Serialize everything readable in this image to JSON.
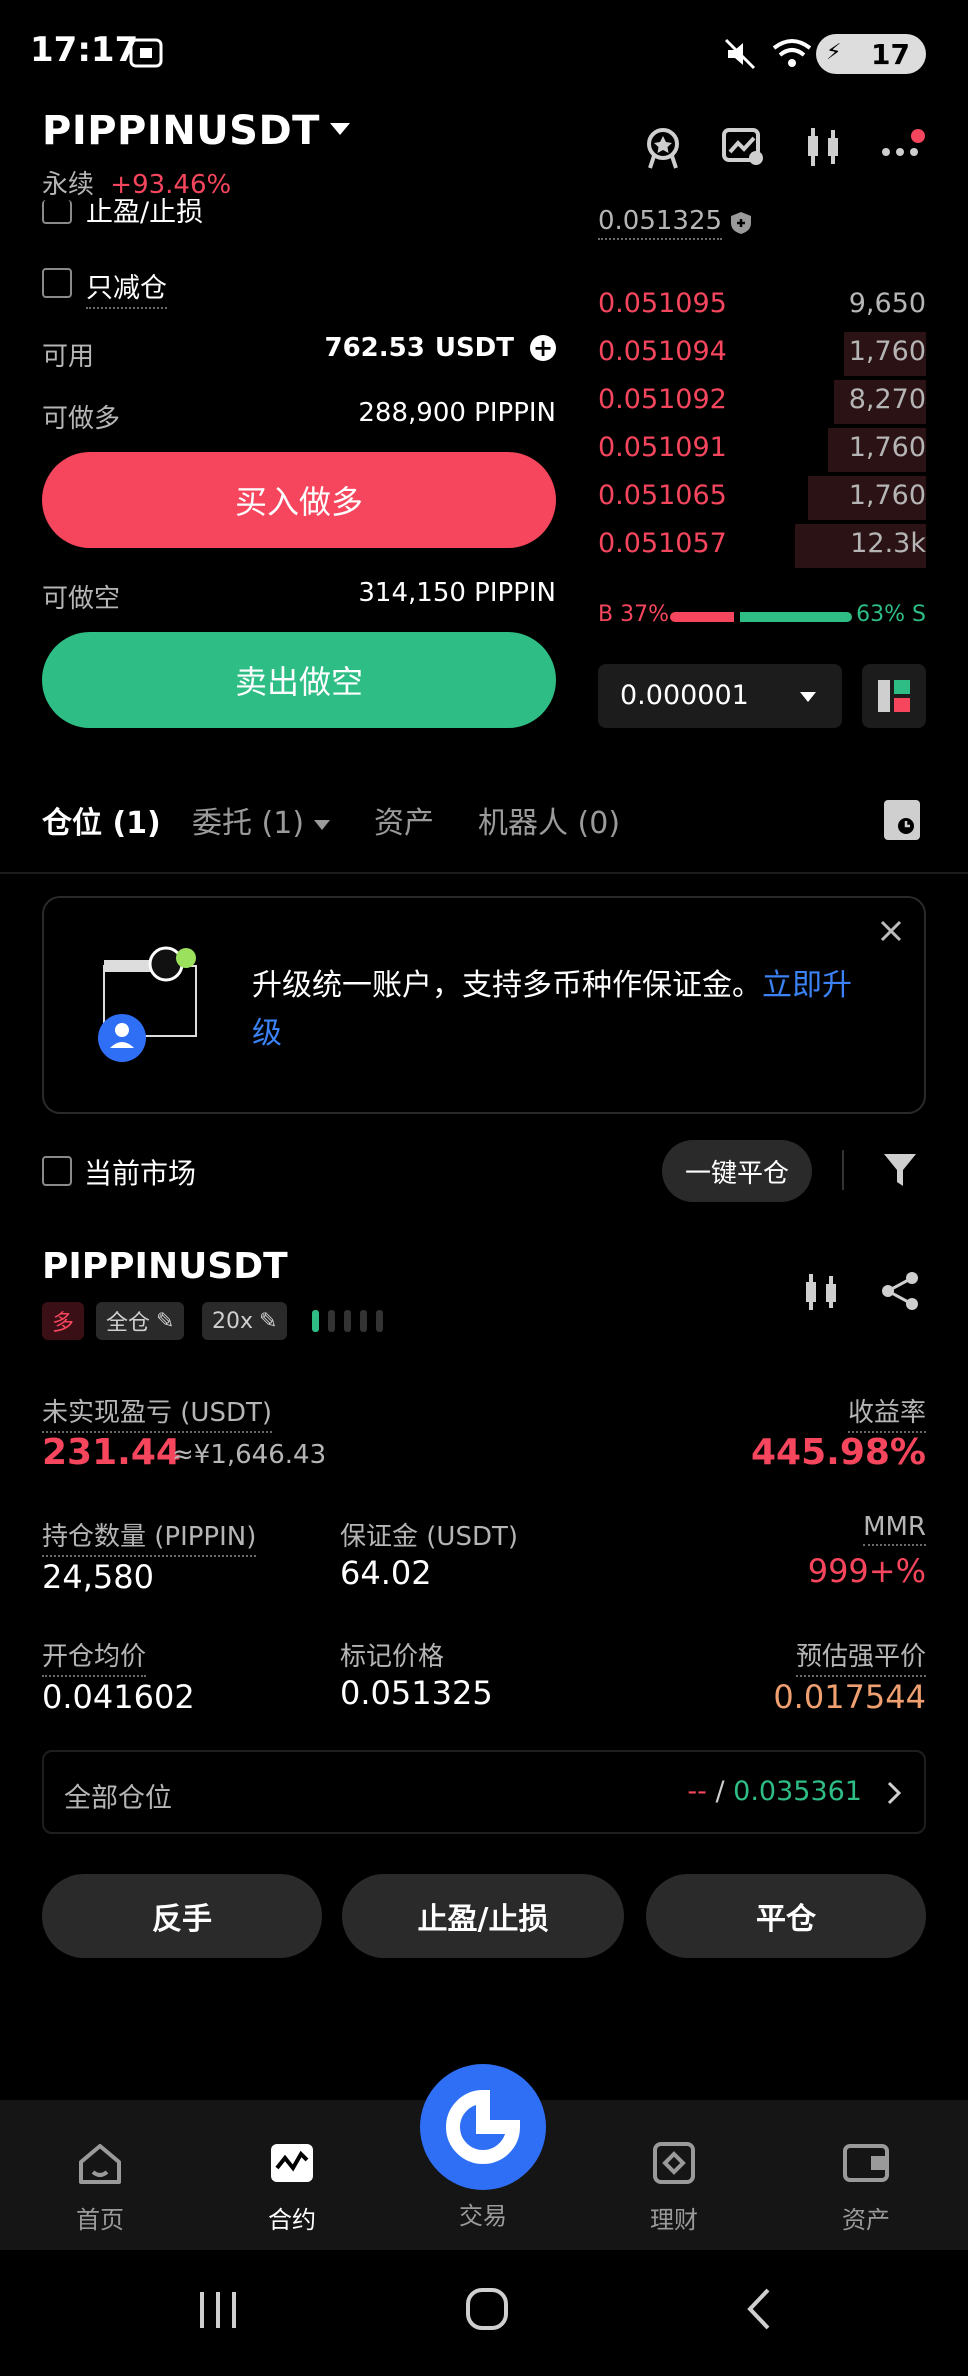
{
  "status_bar": {
    "time": "17:17",
    "battery": "17"
  },
  "header": {
    "symbol": "PIPPINUSDT",
    "contract_type": "永续",
    "change_pct": "+93.46%"
  },
  "order_panel": {
    "tpsl_label": "止盈/止损",
    "reduce_only_label": "只减仓",
    "available_label": "可用",
    "available_value": "762.53",
    "available_unit": "USDT",
    "can_long_label": "可做多",
    "can_long_value": "288,900 PIPPIN",
    "buy_button": "买入做多",
    "can_short_label": "可做空",
    "can_short_value": "314,150 PIPPIN",
    "sell_button": "卖出做空"
  },
  "orderbook": {
    "mark_price": "0.051325",
    "asks": [
      {
        "price": "0.051095",
        "qty": "9,650",
        "depth": 0.0
      },
      {
        "price": "0.051094",
        "qty": "1,760",
        "depth": 0.25
      },
      {
        "price": "0.051092",
        "qty": "8,270",
        "depth": 0.28
      },
      {
        "price": "0.051091",
        "qty": "1,760",
        "depth": 0.3
      },
      {
        "price": "0.051065",
        "qty": "1,760",
        "depth": 0.36
      },
      {
        "price": "0.051057",
        "qty": "12.3k",
        "depth": 0.4
      }
    ],
    "buy_ratio_label": "B 37%",
    "sell_ratio_label": "63% S",
    "buy_ratio": 0.37,
    "precision": "0.000001"
  },
  "tabs": [
    {
      "label": "仓位 (1)"
    },
    {
      "label": "委托 (1)"
    },
    {
      "label": "资产"
    },
    {
      "label": "机器人 (0)"
    }
  ],
  "banner": {
    "text": "升级统一账户，支持多币种作保证金。",
    "link": "立即升级"
  },
  "filter": {
    "current_market": "当前市场",
    "close_all": "一键平仓"
  },
  "position": {
    "symbol": "PIPPINUSDT",
    "side": "多",
    "margin_mode": "全仓",
    "leverage": "20x",
    "unrealized_label": "未实现盈亏 (USDT)",
    "unrealized_value": "231.44",
    "unrealized_cny": "≈¥1,646.43",
    "roe_label": "收益率",
    "roe_value": "445.98%",
    "qty_label": "持仓数量 (PIPPIN)",
    "qty_value": "24,580",
    "margin_label": "保证金 (USDT)",
    "margin_value": "64.02",
    "mmr_label": "MMR",
    "mmr_value": "999+%",
    "entry_label": "开仓均价",
    "entry_value": "0.041602",
    "mark_label": "标记价格",
    "mark_value": "0.051325",
    "liq_label": "预估强平价",
    "liq_value": "0.017544",
    "all_positions_label": "全部仓位",
    "all_positions_left": "--",
    "all_positions_sep": "/",
    "all_positions_right": "0.035361",
    "btn_reverse": "反手",
    "btn_tpsl": "止盈/止损",
    "btn_close": "平仓"
  },
  "bottom_nav": [
    {
      "label": "首页"
    },
    {
      "label": "合约"
    },
    {
      "label": "交易"
    },
    {
      "label": "理财"
    },
    {
      "label": "资产"
    }
  ],
  "colors": {
    "red": "#f6465d",
    "green": "#2ebd85",
    "blue": "#2f6ff5",
    "orange": "#f0a070"
  }
}
